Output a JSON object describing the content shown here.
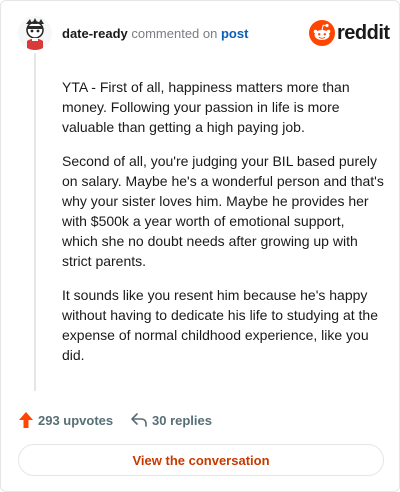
{
  "header": {
    "username": "date-ready",
    "action": " commented on ",
    "target": "post",
    "brand": "reddit"
  },
  "comment": {
    "paragraphs": [
      "YTA - First of all, happiness matters more than money. Following your passion in life is more valuable than getting a high paying job.",
      "Second of all, you're judging your BIL based purely on salary. Maybe he's a wonderful person and that's why your sister loves him. Maybe he provides her with $500k a year worth of emotional support, which she no doubt needs after growing up with strict parents.",
      "It sounds like you resent him because he's happy without having to dedicate his life to studying at the expense of normal childhood experience, like you did."
    ]
  },
  "footer": {
    "upvotes": "293 upvotes",
    "replies": "30 replies",
    "view_button": "View the conversation"
  },
  "icons": {
    "avatar": "avatar",
    "logo": "reddit-logo-icon",
    "upvote": "upvote-arrow-icon",
    "reply": "reply-arrow-icon"
  },
  "colors": {
    "brand_orange": "#ff4500",
    "link_blue": "#0a5fb4",
    "button_text": "#c63a00",
    "muted": "#576f76"
  }
}
